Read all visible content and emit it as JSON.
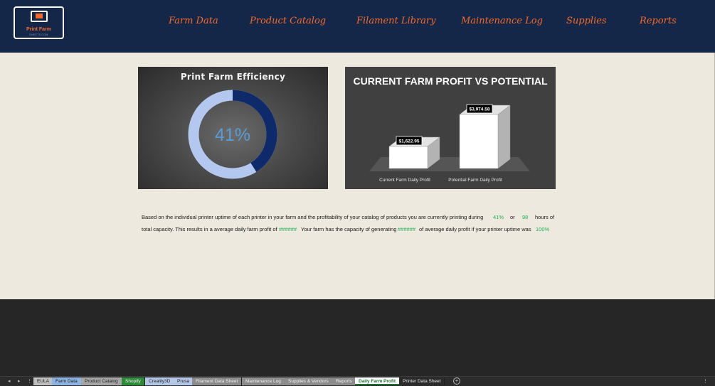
{
  "logo": {
    "title": "Print Farm",
    "subtitle": "SHEETS.COM"
  },
  "nav": [
    {
      "label": "Farm Data"
    },
    {
      "label": "Product Catalog"
    },
    {
      "label": "Filament Library"
    },
    {
      "label": "Maintenance Log"
    },
    {
      "label": "Supplies"
    },
    {
      "label": "Reports"
    }
  ],
  "efficiency": {
    "title": "Print Farm Efficiency",
    "value_label": "41%",
    "fraction": 0.41,
    "fill_color": "#0e2a6b",
    "remain_color": "#b4c8ef",
    "text_color": "#5b9bd5"
  },
  "chart_data": {
    "type": "bar",
    "title": "CURRENT FARM PROFIT VS POTENTIAL",
    "categories": [
      "Current Farm Daily Profit",
      "Potential Farm Daily Profit"
    ],
    "values": [
      1622.95,
      3974.58
    ],
    "data_labels": [
      "$1,622.95",
      "$3,974.58"
    ],
    "style": "3d-box",
    "bar_color": "#ffffff",
    "legend": "none",
    "grid": false
  },
  "summary": {
    "line1_text": "Based on the individual printer uptime of each printer in your farm and the profitability of your catalog of products you are currently printing during",
    "uptime_pct": "41%",
    "or_text": "or",
    "hours_value": "98",
    "hours_text": "hours of",
    "line2_a": "total capacity.  This results in a average daily farm profit of",
    "profit_hash": "######",
    "line2_b": "Your farm has the capacity of generating",
    "potential_hash": "######",
    "line2_c": "of average daily profit if your printer uptime was",
    "full_pct": "100%"
  },
  "tabs": [
    {
      "label": "EULA",
      "cls": "t-eula"
    },
    {
      "label": "Farm Data",
      "cls": "t-farm"
    },
    {
      "label": "Product Catalog",
      "cls": "t-catalog"
    },
    {
      "label": "Shopify",
      "cls": "t-shopify"
    },
    {
      "label": "Creality3D",
      "cls": "t-creality"
    },
    {
      "label": "Prusa",
      "cls": "t-prusa"
    },
    {
      "label": "Filament Data Sheet",
      "cls": "t-filament"
    },
    {
      "label": "Maintenance Log",
      "cls": "t-maint"
    },
    {
      "label": "Supplies & Vendors",
      "cls": "t-supplies"
    },
    {
      "label": "Reports",
      "cls": "t-reports"
    },
    {
      "label": "Daily Farm Profit",
      "cls": "t-daily",
      "active": true
    },
    {
      "label": "Printer Data Sheet",
      "cls": "t-printer"
    }
  ],
  "tab_add_label": "+",
  "tab_prev_icon": "◂",
  "tab_next_icon": "▸",
  "tab_more_icon": "⋮"
}
